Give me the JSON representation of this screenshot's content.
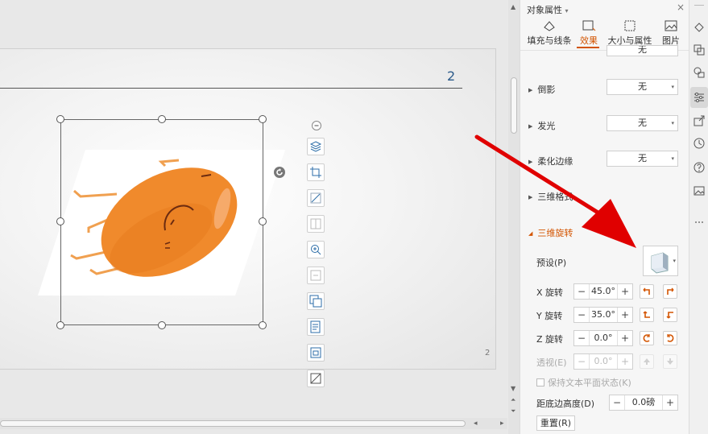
{
  "slide": {
    "page_number_top": "2",
    "page_number_bottom": "2"
  },
  "panel": {
    "title": "对象属性",
    "title_dropdown": "▾",
    "close": "×",
    "tabs": [
      {
        "label": "填充与线条",
        "icon": "fill-line-icon"
      },
      {
        "label": "效果",
        "icon": "effects-icon",
        "active": true
      },
      {
        "label": "大小与属性",
        "icon": "size-properties-icon"
      },
      {
        "label": "图片",
        "icon": "picture-icon"
      }
    ],
    "partial_top_value": "无",
    "sections": [
      {
        "label": "倒影",
        "value": "无"
      },
      {
        "label": "发光",
        "value": "无"
      },
      {
        "label": "柔化边缘",
        "value": "无"
      },
      {
        "label": "三维格式"
      }
    ],
    "rotation3d": {
      "label": "三维旋转",
      "preset_label": "预设(P)",
      "x_label": "X 旋转",
      "x_value": "45.0°",
      "y_label": "Y 旋转",
      "y_value": "35.0°",
      "z_label": "Z 旋转",
      "z_value": "0.0°",
      "perspective_label": "透视(E)",
      "perspective_value": "0.0°",
      "keep_flat_label": "保持文本平面状态(K)",
      "distance_label": "距底边高度(D)",
      "distance_value": "0.0磅",
      "reset_label": "重置(R)"
    },
    "minus": "−",
    "plus": "+"
  },
  "colors": {
    "accent": "#d35400",
    "arrow": "#e00000",
    "potato": "#f08a2c"
  }
}
